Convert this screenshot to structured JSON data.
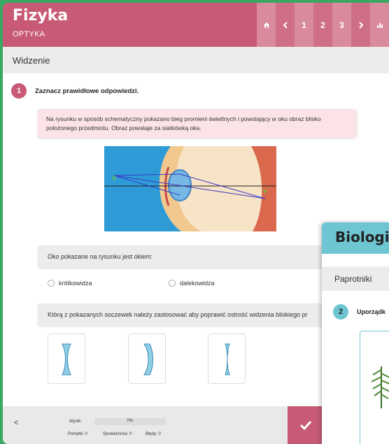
{
  "header": {
    "title": "Fizyka",
    "subtitle": "OPTYKA",
    "nav": [
      "home-icon",
      "chevron-left-icon",
      "1",
      "2",
      "3",
      "chevron-right-icon",
      "chart-icon"
    ]
  },
  "section": {
    "label": "Widzenie"
  },
  "question1": {
    "number": "1",
    "prompt": "Zaznacz prawidłowe odpowiedzi.",
    "info": "Na rysunku w sposób schematyczny pokazano bieg promieni świetlnych i powstający w oku obraz blisko położonego przedmiotu. Obraz powstaje za siatkówką oka.",
    "sub1": {
      "text": "Oko pokazane na rysunku jest okiem:",
      "options": [
        "krótkowidza",
        "dalekowidza"
      ]
    },
    "sub2": {
      "text": "Którą z pokazanych soczewek należy zastosować aby poprawić ostrość widzenia bliskiego pr"
    }
  },
  "footer": {
    "prev_label": "<",
    "result_label": "Wynik:",
    "result_value": "0%",
    "mistakes": "Pomyłki: 0",
    "checks": "Sprawdzenia: 0",
    "errors": "Błędy: 0"
  },
  "card2": {
    "title": "Biologia",
    "section": "Paprotniki",
    "number": "2",
    "prompt": "Uporządk"
  },
  "colors": {
    "accent": "#c85a75",
    "accent2": "#6ec6d3",
    "bg": "#3aa860"
  }
}
